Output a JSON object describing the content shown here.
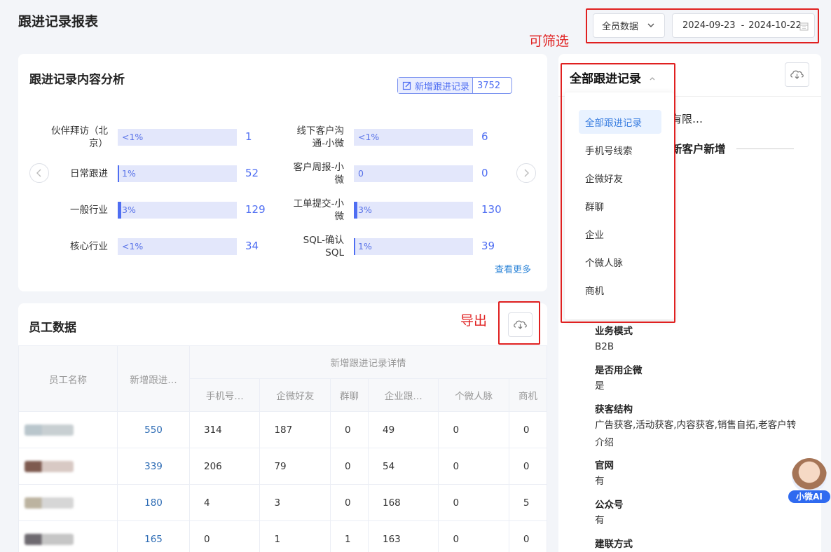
{
  "page": {
    "title": "跟进记录报表"
  },
  "filters": {
    "scope_value": "全员数据",
    "date_start": "2024-09-23",
    "date_sep": "-",
    "date_end": "2024-10-22"
  },
  "annotations": {
    "filter_note": "可筛选",
    "export_note": "导出"
  },
  "analysis": {
    "title": "跟进记录内容分析",
    "badge_label": "新增跟进记录",
    "badge_value": "3752",
    "more_link": "查看更多",
    "left": [
      {
        "label": "伙伴拜访（北\n京）",
        "pct": "<1%",
        "fill": 0,
        "value": "1"
      },
      {
        "label": "日常跟进",
        "pct": "1%",
        "fill": 0.01,
        "value": "52"
      },
      {
        "label": "一般行业",
        "pct": "3%",
        "fill": 0.03,
        "value": "129"
      },
      {
        "label": "核心行业",
        "pct": "<1%",
        "fill": 0,
        "value": "34"
      }
    ],
    "right": [
      {
        "label": "线下客户沟\n通-小微",
        "pct": "<1%",
        "fill": 0,
        "value": "6"
      },
      {
        "label": "客户周报-小\n微",
        "pct": "0",
        "fill": 0,
        "value": "0"
      },
      {
        "label": "工单提交-小\n微",
        "pct": "3%",
        "fill": 0.03,
        "value": "130"
      },
      {
        "label": "SQL-确认\nSQL",
        "pct": "1%",
        "fill": 0.01,
        "value": "39"
      }
    ]
  },
  "employees": {
    "title": "员工数据",
    "headers": {
      "name": "员工名称",
      "new": "新增跟进…",
      "group": "新增跟进记录详情",
      "cols": [
        "手机号…",
        "企微好友",
        "群聊",
        "企业跟…",
        "个微人脉",
        "商机"
      ]
    },
    "rows": [
      {
        "total": "550",
        "cells": [
          "314",
          "187",
          "0",
          "49",
          "0",
          "0"
        ]
      },
      {
        "total": "339",
        "cells": [
          "206",
          "79",
          "0",
          "54",
          "0",
          "0"
        ]
      },
      {
        "total": "180",
        "cells": [
          "4",
          "3",
          "0",
          "168",
          "0",
          "5"
        ]
      },
      {
        "total": "165",
        "cells": [
          "0",
          "1",
          "1",
          "163",
          "0",
          "0"
        ]
      }
    ]
  },
  "records": {
    "dropdown_label": "全部跟进记录",
    "options": [
      "全部跟进记录",
      "手机号线索",
      "企微好友",
      "群聊",
      "企业",
      "个微人脉",
      "商机"
    ],
    "selected": "全部跟进记录",
    "partial_company": "有限…",
    "section_title": "新客户新增",
    "details": [
      {
        "label": "业务模式",
        "value": "B2B"
      },
      {
        "label": "是否用企微",
        "value": "是"
      },
      {
        "label": "获客结构",
        "value": "广告获客,活动获客,内容获客,销售自拓,老客户转介绍"
      },
      {
        "label": "官网",
        "value": "有"
      },
      {
        "label": "公众号",
        "value": "有"
      },
      {
        "label": "建联方式",
        "value": ""
      }
    ]
  },
  "assistant": {
    "label": "小微AI"
  }
}
